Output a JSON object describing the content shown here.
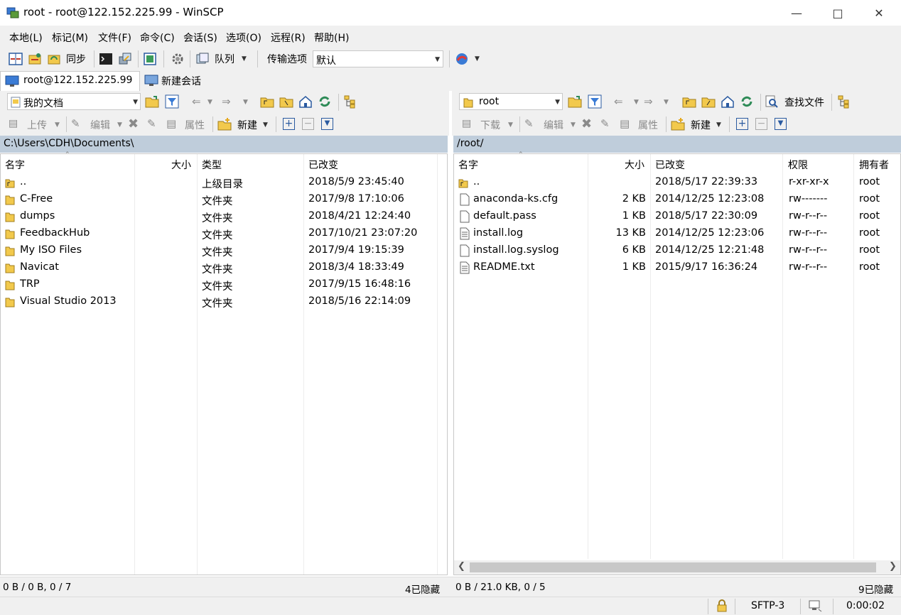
{
  "window": {
    "title": "root - root@122.152.225.99 - WinSCP"
  },
  "menu": [
    "本地(L)",
    "标记(M)",
    "文件(F)",
    "命令(C)",
    "会话(S)",
    "选项(O)",
    "远程(R)",
    "帮助(H)"
  ],
  "toolbar": {
    "sync_label": "同步",
    "queue_label": "队列",
    "transfer_label": "传输选项",
    "transfer_value": "默认"
  },
  "tabs": {
    "session": "root@122.152.225.99",
    "new_session": "新建会话"
  },
  "local": {
    "location": "我的文档",
    "path": "C:\\Users\\CDH\\Documents\\",
    "actions": {
      "upload": "上传",
      "edit": "编辑",
      "properties": "属性",
      "new": "新建"
    },
    "columns": [
      "名字",
      "大小",
      "类型",
      "已改变"
    ],
    "rows": [
      {
        "name": "..",
        "size": "",
        "type": "上级目录",
        "changed": "2018/5/9  23:45:40",
        "kind": "parent"
      },
      {
        "name": "C-Free",
        "size": "",
        "type": "文件夹",
        "changed": "2017/9/8  17:10:06",
        "kind": "folder"
      },
      {
        "name": "dumps",
        "size": "",
        "type": "文件夹",
        "changed": "2018/4/21  12:24:40",
        "kind": "folder"
      },
      {
        "name": "FeedbackHub",
        "size": "",
        "type": "文件夹",
        "changed": "2017/10/21  23:07:20",
        "kind": "folder"
      },
      {
        "name": "My ISO Files",
        "size": "",
        "type": "文件夹",
        "changed": "2017/9/4  19:15:39",
        "kind": "folder"
      },
      {
        "name": "Navicat",
        "size": "",
        "type": "文件夹",
        "changed": "2018/3/4  18:33:49",
        "kind": "folder"
      },
      {
        "name": "TRP",
        "size": "",
        "type": "文件夹",
        "changed": "2017/9/15  16:48:16",
        "kind": "folder"
      },
      {
        "name": "Visual Studio 2013",
        "size": "",
        "type": "文件夹",
        "changed": "2018/5/16  22:14:09",
        "kind": "folder"
      }
    ],
    "status_left": "0 B / 0 B,  0 / 7",
    "status_right": "4已隐藏"
  },
  "remote": {
    "location": "root",
    "find_label": "查找文件",
    "path": "/root/",
    "actions": {
      "download": "下载",
      "edit": "编辑",
      "properties": "属性",
      "new": "新建"
    },
    "columns": [
      "名字",
      "大小",
      "已改变",
      "权限",
      "拥有者"
    ],
    "rows": [
      {
        "name": "..",
        "size": "",
        "changed": "2018/5/17 22:39:33",
        "rights": "r-xr-xr-x",
        "owner": "root",
        "kind": "parent"
      },
      {
        "name": "anaconda-ks.cfg",
        "size": "2 KB",
        "changed": "2014/12/25 12:23:08",
        "rights": "rw-------",
        "owner": "root",
        "kind": "file"
      },
      {
        "name": "default.pass",
        "size": "1 KB",
        "changed": "2018/5/17 22:30:09",
        "rights": "rw-r--r--",
        "owner": "root",
        "kind": "file"
      },
      {
        "name": "install.log",
        "size": "13 KB",
        "changed": "2014/12/25 12:23:06",
        "rights": "rw-r--r--",
        "owner": "root",
        "kind": "textfile"
      },
      {
        "name": "install.log.syslog",
        "size": "6 KB",
        "changed": "2014/12/25 12:21:48",
        "rights": "rw-r--r--",
        "owner": "root",
        "kind": "file"
      },
      {
        "name": "README.txt",
        "size": "1 KB",
        "changed": "2015/9/17 16:36:24",
        "rights": "rw-r--r--",
        "owner": "root",
        "kind": "textfile"
      }
    ],
    "status_left": "0 B / 21.0 KB,  0 / 5",
    "status_right": "9已隐藏"
  },
  "statusbar": {
    "protocol": "SFTP-3",
    "time": "0:00:02"
  }
}
